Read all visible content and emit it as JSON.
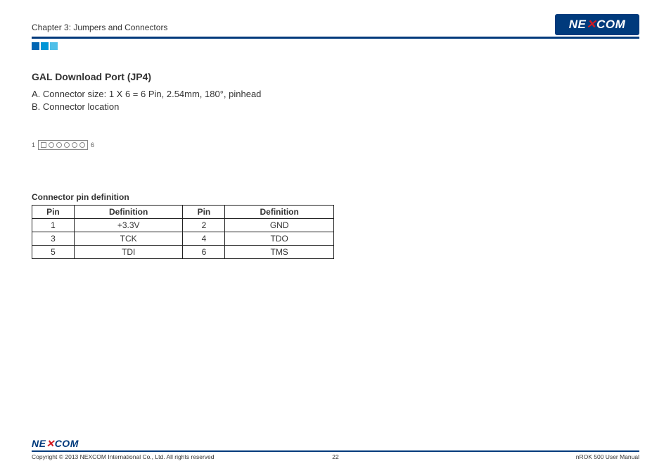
{
  "header": {
    "chapter": "Chapter 3: Jumpers and Connectors",
    "logo": "NEXCOM"
  },
  "section": {
    "title": "GAL Download Port (JP4)",
    "lineA": "A. Connector size: 1 X 6 = 6 Pin, 2.54mm, 180°, pinhead",
    "lineB": "B. Connector location"
  },
  "diagram": {
    "left_label": "1",
    "right_label": "6"
  },
  "table": {
    "heading": "Connector pin definition",
    "col_pin": "Pin",
    "col_def": "Definition",
    "rows": [
      {
        "p1": "1",
        "d1": "+3.3V",
        "p2": "2",
        "d2": "GND"
      },
      {
        "p1": "3",
        "d1": "TCK",
        "p2": "4",
        "d2": "TDO"
      },
      {
        "p1": "5",
        "d1": "TDI",
        "p2": "6",
        "d2": "TMS"
      }
    ]
  },
  "footer": {
    "logo": "NEXCOM",
    "copyright": "Copyright © 2013 NEXCOM International Co., Ltd. All rights reserved",
    "page": "22",
    "manual": "nROK 500 User Manual"
  }
}
